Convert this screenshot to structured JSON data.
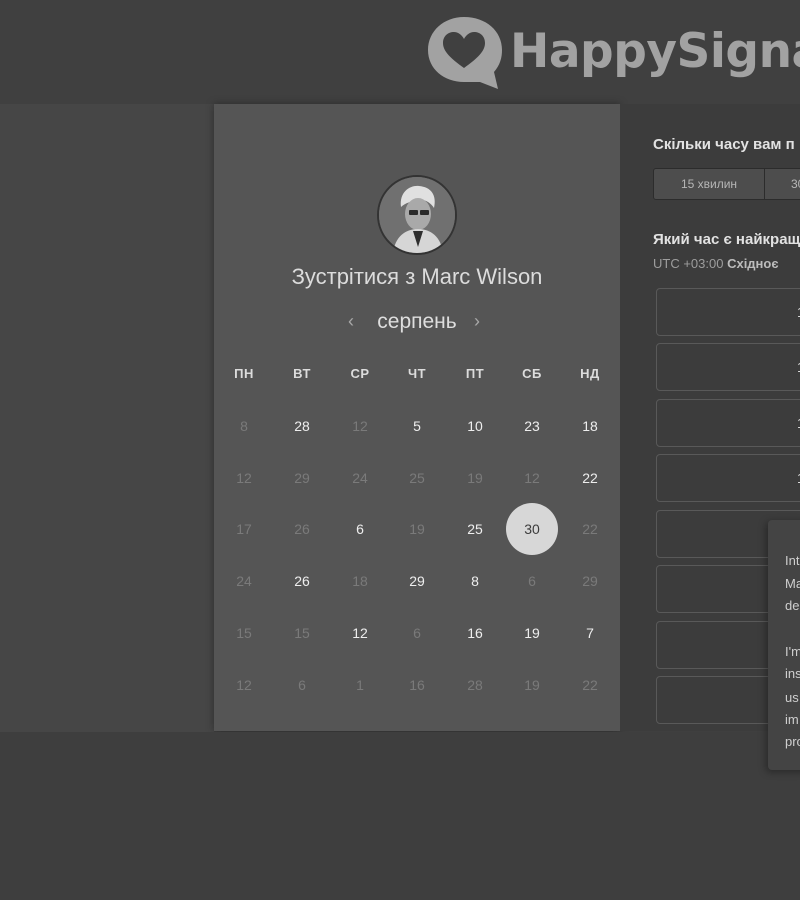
{
  "brand": {
    "name": "HappySignals",
    "logo_icon": "heart-speech-bubble-icon"
  },
  "meeting": {
    "title": "Зустрітися з Marc Wilson",
    "avatar_alt": "Marc Wilson avatar"
  },
  "calendar": {
    "month": "серпень",
    "prev_icon": "‹",
    "next_icon": "›",
    "weekdays": [
      "ПН",
      "ВТ",
      "СР",
      "ЧТ",
      "ПТ",
      "СБ",
      "НД"
    ],
    "weeks": [
      [
        {
          "d": "8",
          "a": false
        },
        {
          "d": "28",
          "a": true
        },
        {
          "d": "12",
          "a": false
        },
        {
          "d": "5",
          "a": true
        },
        {
          "d": "10",
          "a": true
        },
        {
          "d": "23",
          "a": true
        },
        {
          "d": "18",
          "a": true
        }
      ],
      [
        {
          "d": "12",
          "a": false
        },
        {
          "d": "29",
          "a": false
        },
        {
          "d": "24",
          "a": false
        },
        {
          "d": "25",
          "a": false
        },
        {
          "d": "19",
          "a": false
        },
        {
          "d": "12",
          "a": false
        },
        {
          "d": "22",
          "a": true
        }
      ],
      [
        {
          "d": "17",
          "a": false
        },
        {
          "d": "26",
          "a": false
        },
        {
          "d": "6",
          "a": true
        },
        {
          "d": "19",
          "a": false
        },
        {
          "d": "25",
          "a": true
        },
        {
          "d": "30",
          "a": true,
          "selected": true
        },
        {
          "d": "22",
          "a": false
        }
      ],
      [
        {
          "d": "24",
          "a": false
        },
        {
          "d": "26",
          "a": true
        },
        {
          "d": "18",
          "a": false
        },
        {
          "d": "29",
          "a": true
        },
        {
          "d": "8",
          "a": true
        },
        {
          "d": "6",
          "a": false
        },
        {
          "d": "29",
          "a": false
        }
      ],
      [
        {
          "d": "15",
          "a": false
        },
        {
          "d": "15",
          "a": false
        },
        {
          "d": "12",
          "a": true
        },
        {
          "d": "6",
          "a": false
        },
        {
          "d": "16",
          "a": true
        },
        {
          "d": "19",
          "a": true
        },
        {
          "d": "7",
          "a": true
        }
      ],
      [
        {
          "d": "12",
          "a": false
        },
        {
          "d": "6",
          "a": false
        },
        {
          "d": "1",
          "a": false
        },
        {
          "d": "16",
          "a": false
        },
        {
          "d": "28",
          "a": false
        },
        {
          "d": "19",
          "a": false
        },
        {
          "d": "22",
          "a": false
        }
      ]
    ]
  },
  "scheduler": {
    "duration_question": "Скільки часу вам п",
    "durations": [
      "15 хвилин",
      "30"
    ],
    "time_question": "Який час є найкращ",
    "timezone_offset": "UTC +03:00",
    "timezone_name": "Східноє",
    "slot_label": "1",
    "slot_count": 8
  },
  "cookie_popup": {
    "lines": [
      "Int",
      "Ma",
      "de",
      "",
      "I'm",
      "ins",
      "us",
      "im",
      "pro"
    ]
  }
}
